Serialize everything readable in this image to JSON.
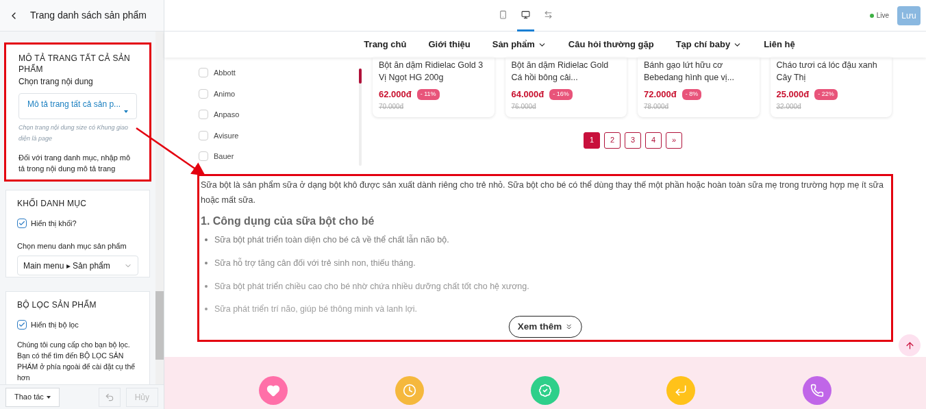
{
  "sidebar": {
    "title": "Trang danh sách sản phẩm",
    "description_section": {
      "heading": "MÔ TẢ TRANG TẤT CẢ SẢN PHẨM",
      "label": "Chọn trang nội dung",
      "select_value": "Mô tả trang tất cả sản p...",
      "hint": "Chọn trang nội dung size có Khung giao diện là page",
      "note": "Đối với trang danh mục, nhập mô tả trong nội dung mô tả trang",
      "highlighted": true
    },
    "category_section": {
      "heading": "KHỐI DANH MỤC",
      "checkbox": {
        "label": "Hiển thị khối?",
        "checked": true
      },
      "label": "Chọn menu danh mục sản phẩm",
      "select_value": "Main menu ▸ Sản phẩm"
    },
    "filter_section": {
      "heading": "BỘ LỌC SẢN PHẨM",
      "checkbox": {
        "label": "Hiển thị bộ lọc",
        "checked": true
      },
      "note": "Chúng tôi cung cấp cho bạn bộ lọc. Bạn có thể tìm đến BỘ LỌC SẢN PHẨM ở phía ngoài để cài đặt cụ thể hơn"
    },
    "footer": {
      "actions": "Thao tác",
      "cancel": "Hủy"
    }
  },
  "toolbar": {
    "devices": [
      {
        "kind": "mobile",
        "selected": false
      },
      {
        "kind": "desktop",
        "selected": true
      },
      {
        "kind": "fullwidth",
        "selected": false
      }
    ],
    "status": "Live",
    "save": "Lưu"
  },
  "nav": [
    {
      "label": "Trang chủ",
      "dropdown": false
    },
    {
      "label": "Giới thiệu",
      "dropdown": false
    },
    {
      "label": "Sản phẩm",
      "dropdown": true
    },
    {
      "label": "Câu hỏi thường gặp",
      "dropdown": false
    },
    {
      "label": "Tạp chí baby",
      "dropdown": true
    },
    {
      "label": "Liên hệ",
      "dropdown": false
    }
  ],
  "brands": [
    {
      "label": "Abbott",
      "checked": false
    },
    {
      "label": "Animo",
      "checked": false
    },
    {
      "label": "Anpaso",
      "checked": false
    },
    {
      "label": "Avisure",
      "checked": false
    },
    {
      "label": "Bauer",
      "checked": false
    }
  ],
  "products": [
    {
      "name": "Bột ăn dặm Ridielac Gold 3 Vị Ngọt HG 200g",
      "price": "62.000đ",
      "discount": "- 11%",
      "old_price": "70.000đ"
    },
    {
      "name": "Bột ăn dặm Ridielac Gold Cá hồi bông cải...",
      "price": "64.000đ",
      "discount": "- 16%",
      "old_price": "76.000đ"
    },
    {
      "name": "Bánh gạo lứt hữu cơ Bebedang hình que vị...",
      "price": "72.000đ",
      "discount": "- 8%",
      "old_price": "78.000đ"
    },
    {
      "name": "Cháo tươi cá lóc đậu xanh Cây Thị",
      "price": "25.000đ",
      "discount": "- 22%",
      "old_price": "32.000đ"
    }
  ],
  "pagination": [
    {
      "label": "1",
      "selected": true
    },
    {
      "label": "2",
      "selected": false
    },
    {
      "label": "3",
      "selected": false
    },
    {
      "label": "4",
      "selected": false
    },
    {
      "label": "»",
      "selected": false
    }
  ],
  "description": {
    "intro": "Sữa bột là sản phẩm sữa ở dạng bột khô được sản xuất dành riêng cho trẻ nhỏ. Sữa bột cho bé có thể dùng thay thế một phần hoặc hoàn toàn sữa mẹ trong trường hợp mẹ ít sữa hoặc mất sữa.",
    "heading": "1. Công dụng của sữa bột cho bé",
    "bullets": [
      "Sữa bột phát triển toàn diện cho bé cả về thể chất lẫn não bộ.",
      "Sữa hỗ trợ tăng cân đối với trẻ sinh non, thiếu tháng.",
      "Sữa bột phát triển chiều cao cho bé nhờ chứa nhiều dưỡng chất tốt cho hệ xương.",
      "Sữa phát triển trí não, giúp bé thông minh và lanh lợi."
    ],
    "more": "Xem thêm",
    "highlighted": true
  },
  "features": [
    {
      "kind": "heart",
      "color": "#ff6fa8"
    },
    {
      "kind": "clock",
      "color": "#f5b83d"
    },
    {
      "kind": "badge",
      "color": "#2ecf8a"
    },
    {
      "kind": "return",
      "color": "#ffc21a"
    },
    {
      "kind": "phone",
      "color": "#c066e8"
    }
  ]
}
